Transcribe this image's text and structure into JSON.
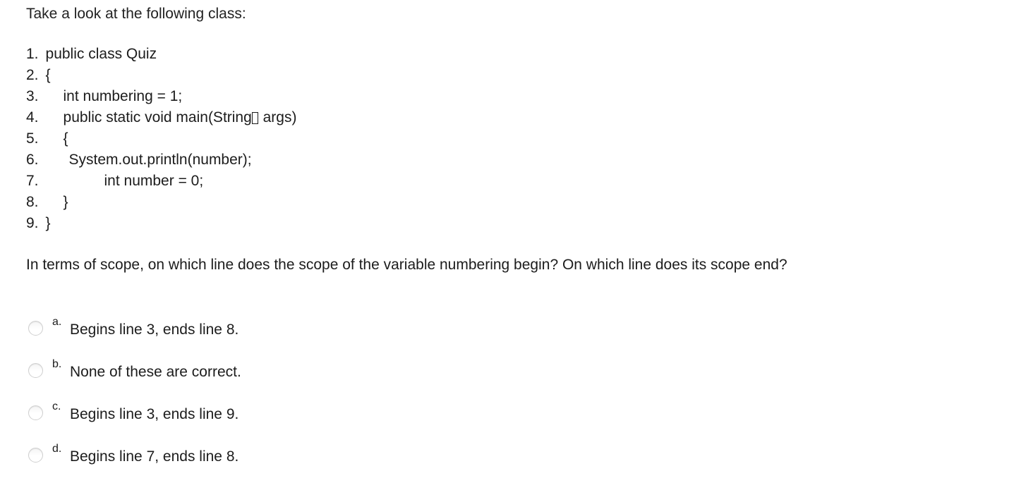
{
  "intro": {
    "text": "Take a look at the following class:"
  },
  "code": {
    "lines": [
      {
        "number": "1.",
        "indent": 0,
        "text": "public class Quiz"
      },
      {
        "number": "2.",
        "indent": 0,
        "text": "{"
      },
      {
        "number": "3.",
        "indent": 25,
        "text": "int numbering = 1;"
      },
      {
        "number": "4.",
        "indent": 25,
        "text_before": "public static void main(String",
        "glyph": "box-bracket",
        "text_after": " args)"
      },
      {
        "number": "5.",
        "indent": 25,
        "text": "{"
      },
      {
        "number": "6.",
        "indent": 33,
        "text": "System.out.println(number);"
      },
      {
        "number": "7.",
        "indent": 83,
        "text": "int number = 0;"
      },
      {
        "number": "8.",
        "indent": 25,
        "text": "}"
      },
      {
        "number": "9.",
        "indent": 0,
        "text": "}"
      }
    ]
  },
  "question": {
    "text": "In terms of scope, on which line does the scope of the variable numbering begin? On which line does its scope end?"
  },
  "answers": {
    "options": [
      {
        "letter": "a.",
        "text": "Begins line 3, ends line 8.",
        "selected": false
      },
      {
        "letter": "b.",
        "text": "None of these are correct.",
        "selected": false
      },
      {
        "letter": "c.",
        "text": "Begins line 3, ends line 9.",
        "selected": false
      },
      {
        "letter": "d.",
        "text": "Begins line 7, ends line 8.",
        "selected": false
      }
    ]
  },
  "colors": {
    "background": "#ffffff",
    "text": "#1c1c1c",
    "radio_border": "#cfcfcf"
  }
}
